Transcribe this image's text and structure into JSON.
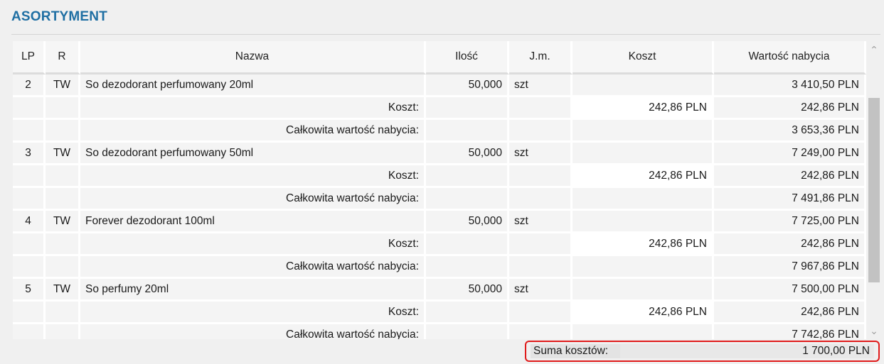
{
  "section_title": "ASORTYMENT",
  "columns": [
    "LP",
    "R",
    "Nazwa",
    "Ilość",
    "J.m.",
    "Koszt",
    "Wartość nabycia"
  ],
  "rows": [
    {
      "kind": "item",
      "lp": "2",
      "r": "TW",
      "nazwa": "So dezodorant perfumowany 20ml",
      "ilosc": "50,000",
      "jm": "szt",
      "koszt": "",
      "wartosc": "3 410,50 PLN"
    },
    {
      "kind": "cost",
      "label": "Koszt:",
      "koszt": "242,86 PLN",
      "wartosc": "242,86 PLN"
    },
    {
      "kind": "total",
      "label": "Całkowita wartość nabycia:",
      "wartosc": "3 653,36 PLN"
    },
    {
      "kind": "item",
      "lp": "3",
      "r": "TW",
      "nazwa": "So dezodorant perfumowany 50ml",
      "ilosc": "50,000",
      "jm": "szt",
      "koszt": "",
      "wartosc": "7 249,00 PLN"
    },
    {
      "kind": "cost",
      "label": "Koszt:",
      "koszt": "242,86 PLN",
      "wartosc": "242,86 PLN"
    },
    {
      "kind": "total",
      "label": "Całkowita wartość nabycia:",
      "wartosc": "7 491,86 PLN"
    },
    {
      "kind": "item",
      "lp": "4",
      "r": "TW",
      "nazwa": "Forever dezodorant 100ml",
      "ilosc": "50,000",
      "jm": "szt",
      "koszt": "",
      "wartosc": "7 725,00 PLN"
    },
    {
      "kind": "cost",
      "label": "Koszt:",
      "koszt": "242,86 PLN",
      "wartosc": "242,86 PLN"
    },
    {
      "kind": "total",
      "label": "Całkowita wartość nabycia:",
      "wartosc": "7 967,86 PLN"
    },
    {
      "kind": "item",
      "lp": "5",
      "r": "TW",
      "nazwa": "So perfumy 20ml",
      "ilosc": "50,000",
      "jm": "szt",
      "koszt": "",
      "wartosc": "7 500,00 PLN"
    },
    {
      "kind": "cost",
      "label": "Koszt:",
      "koszt": "242,86 PLN",
      "wartosc": "242,86 PLN"
    },
    {
      "kind": "total",
      "label": "Całkowita wartość nabycia:",
      "wartosc": "7 742,86 PLN"
    }
  ],
  "summary": {
    "label": "Suma kosztów:",
    "value": "1 700,00 PLN"
  },
  "scrollbar": {
    "up_icon": "chevron-up-icon",
    "down_icon": "chevron-down-icon"
  }
}
